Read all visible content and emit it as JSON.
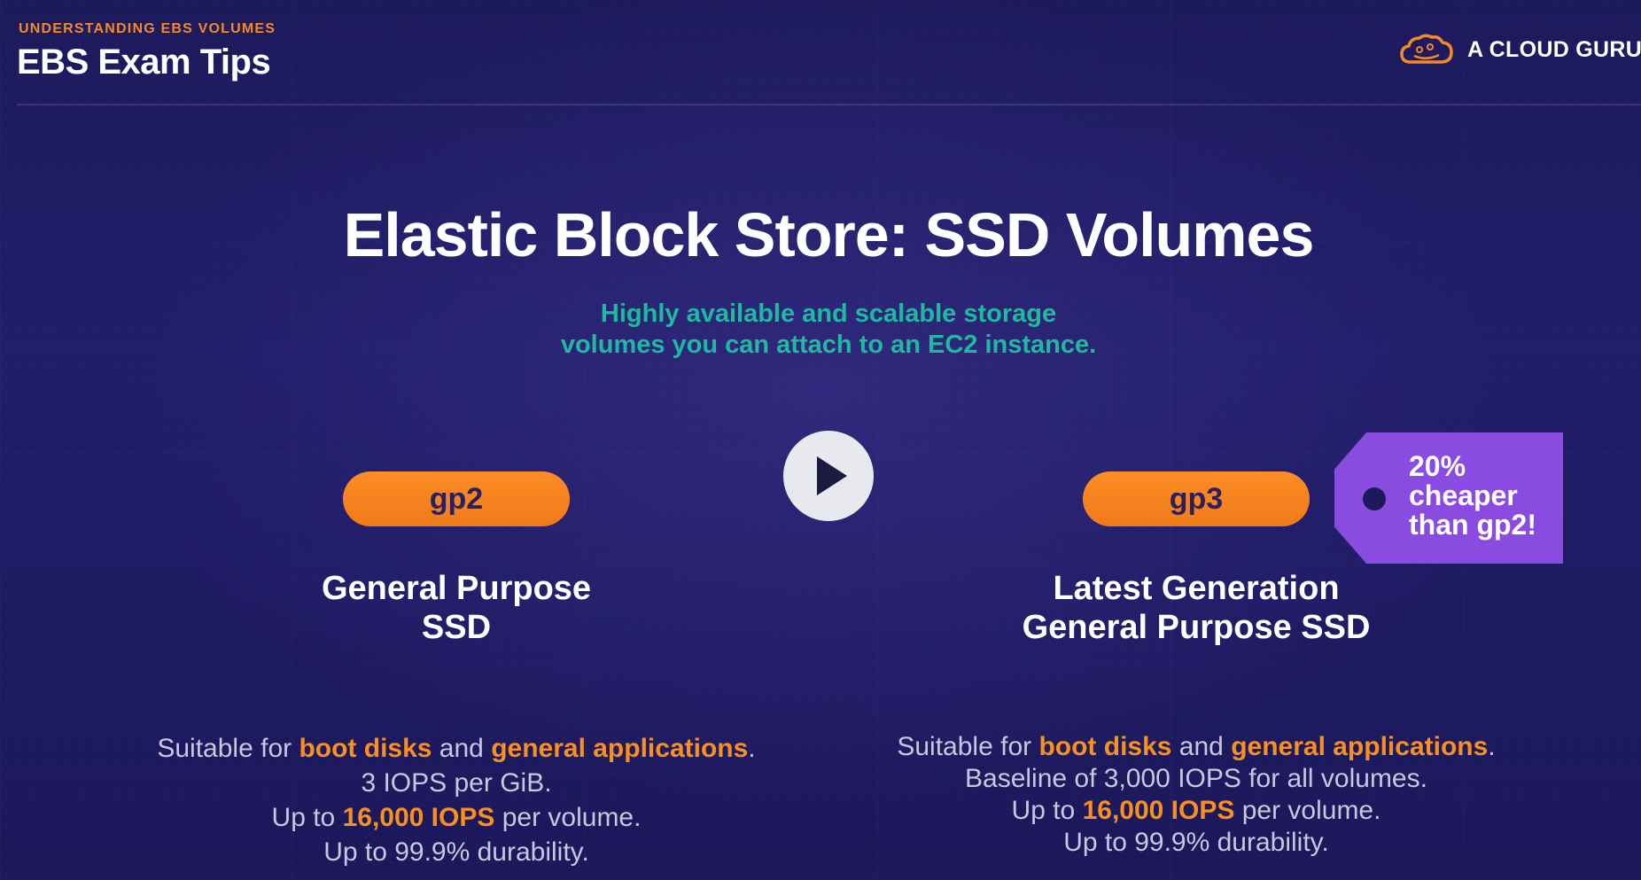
{
  "header": {
    "eyebrow": "UNDERSTANDING EBS VOLUMES",
    "title": "EBS Exam Tips",
    "brand_name": "A CLOUD GURU",
    "brand_icon": "cloud-logo-icon"
  },
  "main": {
    "title": "Elastic Block Store: SSD Volumes",
    "subtitle_line1": "Highly available and scalable storage",
    "subtitle_line2": "volumes you can attach to an EC2 instance."
  },
  "play_icon": "play-icon",
  "gp2": {
    "badge": "gp2",
    "title_line1": "General Purpose",
    "title_line2": "SSD",
    "desc": {
      "l1_a": "Suitable for ",
      "l1_b": "boot disks",
      "l1_c": " and ",
      "l1_d": "general applications",
      "l1_e": ".",
      "l2": "3 IOPS per GiB.",
      "l3_a": "Up to ",
      "l3_b": "16,000 IOPS",
      "l3_c": " per volume.",
      "l4": "Up to 99.9% durability."
    }
  },
  "gp3": {
    "badge": "gp3",
    "title_line1": "Latest Generation",
    "title_line2": "General Purpose SSD",
    "desc": {
      "l1_a": "Suitable for ",
      "l1_b": "boot disks",
      "l1_c": " and ",
      "l1_d": "general applications",
      "l1_e": ".",
      "l2": "Baseline of 3,000 IOPS for all volumes.",
      "l3_a": "Up to ",
      "l3_b": "16,000 IOPS",
      "l3_c": " per volume.",
      "l4": "Up to 99.9% durability."
    },
    "tag_line1": "20%",
    "tag_line2": "cheaper",
    "tag_line3": "than gp2!"
  },
  "colors": {
    "background": "#1d1a5c",
    "accent_orange": "#f7901e",
    "teal": "#1fb8a0",
    "tag_purple": "#8a4ce0"
  }
}
